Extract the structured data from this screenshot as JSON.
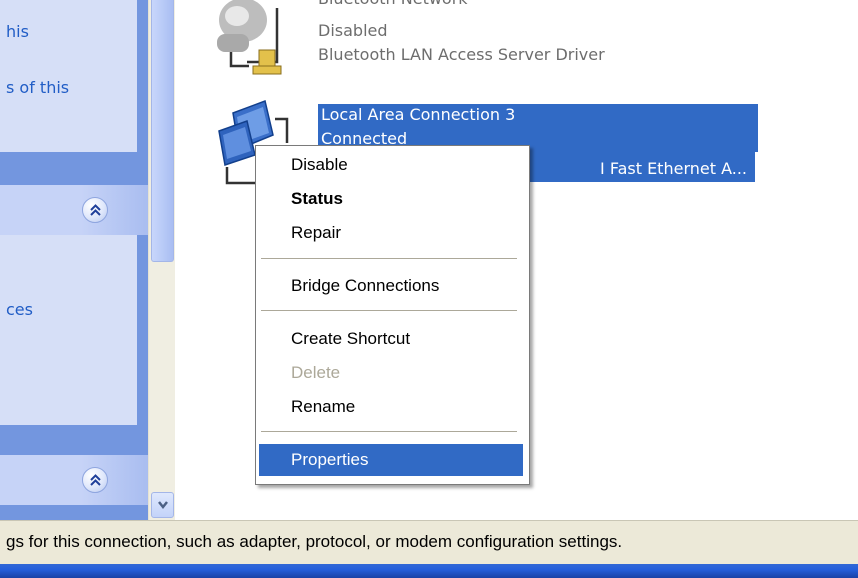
{
  "taskpane": {
    "snippet_1": "his",
    "snippet_2": "s of this",
    "snippet_3": "ces",
    "snippet_4": "his"
  },
  "connections": [
    {
      "name": "Bluetooth Network",
      "status": "Disabled",
      "device": "Bluetooth LAN Access Server Driver",
      "icon": "bluetooth-network-adapter-icon"
    },
    {
      "name": "Local Area Connection 3",
      "status": "Connected",
      "device": "I Fast Ethernet A...",
      "icon": "lan-connection-icon",
      "selected": true
    }
  ],
  "context_menu": {
    "items": [
      {
        "label": "Disable",
        "style": "normal"
      },
      {
        "label": "Status",
        "style": "bold"
      },
      {
        "label": "Repair",
        "style": "normal"
      },
      {
        "label": "Bridge Connections",
        "style": "normal"
      },
      {
        "label": "Create Shortcut",
        "style": "normal"
      },
      {
        "label": "Delete",
        "style": "disabled"
      },
      {
        "label": "Rename",
        "style": "normal"
      },
      {
        "label": "Properties",
        "style": "highlighted"
      }
    ]
  },
  "statusbar": {
    "text": "gs for this connection, such as adapter, protocol, or modem configuration settings."
  },
  "colors": {
    "selection": "#316ac5",
    "taskpane": "#7396df",
    "menu_bg": "#ffffff",
    "statusbar": "#ece9d8"
  }
}
